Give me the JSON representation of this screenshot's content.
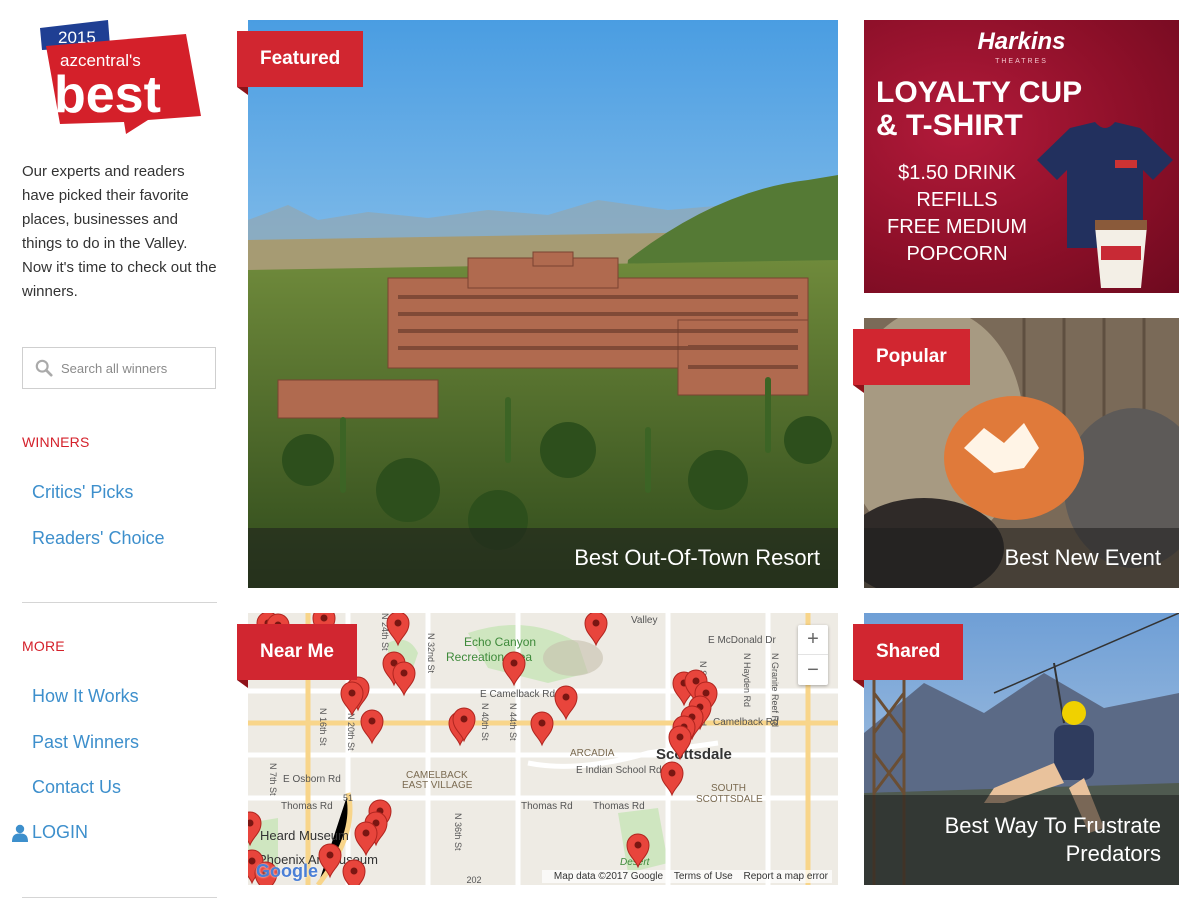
{
  "logo": {
    "year": "2015",
    "site": "azcentral's",
    "title": "best"
  },
  "sidebar": {
    "intro": "Our experts and readers have picked their favorite places, businesses and things to do in the Valley. Now it's time to check out the winners.",
    "search_placeholder": "Search all winners",
    "winners_heading": "WINNERS",
    "winners_links": [
      "Critics' Picks",
      "Readers' Choice"
    ],
    "more_heading": "MORE",
    "more_links": [
      "How It Works",
      "Past Winners",
      "Contact Us"
    ],
    "login_label": "LOGIN"
  },
  "tiles": {
    "featured": {
      "badge": "Featured",
      "caption": "Best Out-Of-Town Resort"
    },
    "popular": {
      "badge": "Popular",
      "caption": "Best New Event"
    },
    "near_me": {
      "badge": "Near Me"
    },
    "shared": {
      "badge": "Shared",
      "caption_line1": "Best Way To Frustrate",
      "caption_line2": "Predators"
    }
  },
  "ad": {
    "brand": "Harkins",
    "brand_sub": "THEATRES",
    "headline_line1": "LOYALTY CUP",
    "headline_line2": "& T-SHIRT",
    "line1": "$1.50 DRINK",
    "line2": "REFILLS",
    "line3": "FREE MEDIUM",
    "line4": "POPCORN",
    "accent_color": "#8b0f28"
  },
  "map": {
    "labels": {
      "valley": "Valley",
      "mcdonald": "E McDonald Dr",
      "echo_canyon": "Echo Canyon",
      "recreation_area": "Recreation Area",
      "camelback_rd": "E Camelback Rd",
      "camelback_rd_east": "Camelback Rd",
      "arcadia": "ARCADIA",
      "indian_school": "E Indian School Rd",
      "scottsdale": "Scottsdale",
      "south_scottsdale_1": "SOUTH",
      "south_scottsdale_2": "SCOTTSDALE",
      "camelback_east_1": "CAMELBACK",
      "camelback_east_2": "EAST VILLAGE",
      "osborn": "E Osborn Rd",
      "thomas_1": "Thomas Rd",
      "thomas_2": "Thomas Rd",
      "thomas_3": "Thomas Rd",
      "heard_museum": "Heard Museum",
      "phoenix_art": "Phoenix Art Museum",
      "desert": "Desert",
      "n_16th": "N 16th St",
      "n_20th": "N 20th St",
      "n_24th": "N 24th St",
      "n_32nd": "N 32nd St",
      "n_40th": "N 40th St",
      "n_44th": "N 44th St",
      "n_36th": "N 36th St",
      "n_7th": "N 7th St",
      "n_hayden": "N Hayden Rd",
      "n_granite": "N Granite Reef Rd",
      "n_scottsdale": "N Scottsdale Rd",
      "route_51": "51",
      "route_202": "202"
    },
    "zoom_in": "+",
    "zoom_out": "−",
    "attribution": "Map data ©2017 Google",
    "terms": "Terms of Use",
    "report": "Report a map error",
    "google": "Google",
    "pin_color": "#e8453c"
  }
}
